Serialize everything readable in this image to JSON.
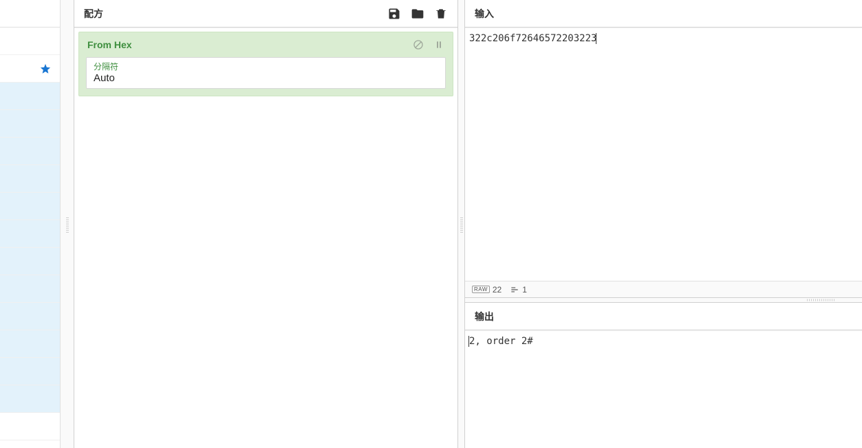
{
  "recipe": {
    "title": "配方",
    "operation": {
      "name": "From Hex",
      "param_label": "分隔符",
      "param_value": "Auto"
    }
  },
  "input": {
    "title": "输入",
    "text": "322c206f72646572203223"
  },
  "status": {
    "raw_count": "22",
    "lines": "1"
  },
  "output": {
    "title": "输出",
    "text": "2, order 2#"
  }
}
